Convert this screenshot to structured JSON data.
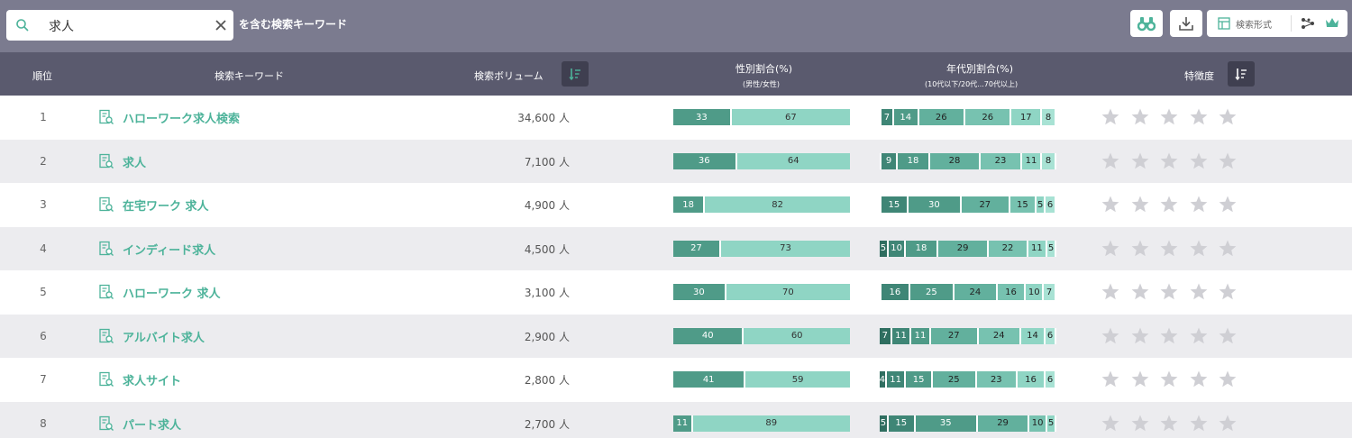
{
  "search": {
    "query": "求人",
    "suffix": "を含む検索キーワード"
  },
  "toolbar": {
    "format_label": "検索形式"
  },
  "columns": {
    "rank": "順位",
    "keyword": "検索キーワード",
    "volume": "検索ボリューム",
    "gender": "性別割合(%)",
    "gender_sub": "(男性/女性)",
    "age": "年代別割合(%)",
    "age_sub": "(10代以下/20代...70代以上)",
    "feature": "特徴度"
  },
  "colors": {
    "accent": "#4db39a",
    "gender_male": "#4f9b88",
    "gender_female": "#8fd5c4",
    "age_scale": [
      "#2f6e60",
      "#3f8676",
      "#4f9b88",
      "#62b09d",
      "#77c2b0",
      "#8fd5c4",
      "#a8e2d4"
    ],
    "star": "#cfcfd4"
  },
  "rows": [
    {
      "rank": "1",
      "keyword": "ハローワーク求人検索",
      "volume": "34,600 人",
      "gender": [
        33,
        67
      ],
      "age": [
        1,
        7,
        14,
        26,
        26,
        17,
        8
      ],
      "stars": 0
    },
    {
      "rank": "2",
      "keyword": "求人",
      "volume": "7,100 人",
      "gender": [
        36,
        64
      ],
      "age": [
        1,
        9,
        18,
        28,
        23,
        11,
        8
      ],
      "stars": 0
    },
    {
      "rank": "3",
      "keyword": "在宅ワーク 求人",
      "volume": "4,900 人",
      "gender": [
        18,
        82
      ],
      "age": [
        1,
        15,
        30,
        27,
        15,
        5,
        6
      ],
      "stars": 0
    },
    {
      "rank": "4",
      "keyword": "インディード求人",
      "volume": "4,500 人",
      "gender": [
        27,
        73
      ],
      "age": [
        5,
        10,
        18,
        29,
        22,
        11,
        5
      ],
      "stars": 0
    },
    {
      "rank": "5",
      "keyword": "ハローワーク 求人",
      "volume": "3,100 人",
      "gender": [
        30,
        70
      ],
      "age": [
        1,
        16,
        25,
        24,
        16,
        10,
        7
      ],
      "stars": 0
    },
    {
      "rank": "6",
      "keyword": "アルバイト求人",
      "volume": "2,900 人",
      "gender": [
        40,
        60
      ],
      "age": [
        7,
        11,
        11,
        27,
        24,
        14,
        6
      ],
      "stars": 0
    },
    {
      "rank": "7",
      "keyword": "求人サイト",
      "volume": "2,800 人",
      "gender": [
        41,
        59
      ],
      "age": [
        4,
        11,
        15,
        25,
        23,
        16,
        6
      ],
      "stars": 0
    },
    {
      "rank": "8",
      "keyword": "パート求人",
      "volume": "2,700 人",
      "gender": [
        11,
        89
      ],
      "age": [
        5,
        15,
        35,
        29,
        10,
        5
      ],
      "stars": 0
    }
  ]
}
